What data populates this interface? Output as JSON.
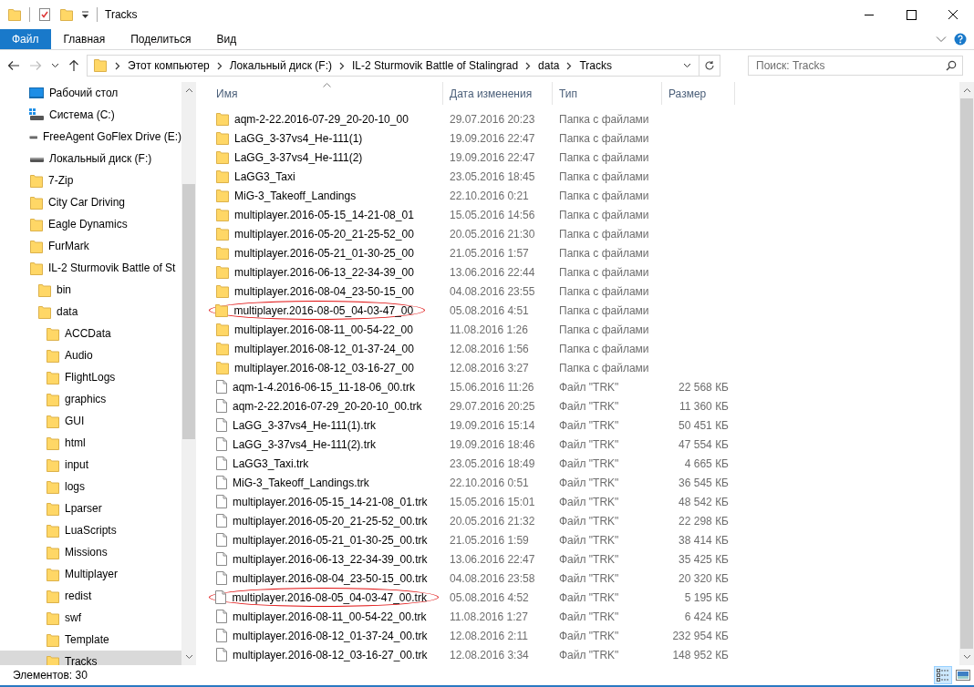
{
  "window": {
    "title": "Tracks"
  },
  "ribbon": {
    "tabs": [
      {
        "label": "Файл",
        "kind": "file-menu"
      },
      {
        "label": "Главная",
        "kind": "tab"
      },
      {
        "label": "Поделиться",
        "kind": "tab"
      },
      {
        "label": "Вид",
        "kind": "tab"
      }
    ]
  },
  "address": {
    "crumbs": [
      "Этот компьютер",
      "Локальный диск (F:)",
      "IL-2 Sturmovik Battle of Stalingrad",
      "data",
      "Tracks"
    ],
    "search_placeholder": "Поиск: Tracks"
  },
  "sidebar": {
    "items": [
      {
        "label": "Рабочий стол",
        "kind": "desktop",
        "selected": false
      },
      {
        "label": "Система (C:)",
        "kind": "system-drive",
        "selected": false
      },
      {
        "label": "FreeAgent GoFlex Drive (E:)",
        "kind": "drive",
        "selected": false
      },
      {
        "label": "Локальный диск (F:)",
        "kind": "drive",
        "selected": false,
        "children": [
          {
            "label": "7-Zip",
            "kind": "folder",
            "selected": false
          },
          {
            "label": "City Car Driving",
            "kind": "folder",
            "selected": false
          },
          {
            "label": "Eagle Dynamics",
            "kind": "folder",
            "selected": false
          },
          {
            "label": "FurMark",
            "kind": "folder",
            "selected": false
          },
          {
            "label": "IL-2 Sturmovik Battle of St",
            "kind": "folder",
            "selected": false,
            "children": [
              {
                "label": "bin",
                "kind": "folder",
                "selected": false
              },
              {
                "label": "data",
                "kind": "folder",
                "selected": false,
                "children": [
                  {
                    "label": "ACCData",
                    "kind": "folder",
                    "selected": false
                  },
                  {
                    "label": "Audio",
                    "kind": "folder",
                    "selected": false
                  },
                  {
                    "label": "FlightLogs",
                    "kind": "folder",
                    "selected": false
                  },
                  {
                    "label": "graphics",
                    "kind": "folder",
                    "selected": false
                  },
                  {
                    "label": "GUI",
                    "kind": "folder",
                    "selected": false
                  },
                  {
                    "label": "html",
                    "kind": "folder",
                    "selected": false
                  },
                  {
                    "label": "input",
                    "kind": "folder",
                    "selected": false
                  },
                  {
                    "label": "logs",
                    "kind": "folder",
                    "selected": false
                  },
                  {
                    "label": "Lparser",
                    "kind": "folder",
                    "selected": false
                  },
                  {
                    "label": "LuaScripts",
                    "kind": "folder",
                    "selected": false
                  },
                  {
                    "label": "Missions",
                    "kind": "folder",
                    "selected": false
                  },
                  {
                    "label": "Multiplayer",
                    "kind": "folder",
                    "selected": false
                  },
                  {
                    "label": "redist",
                    "kind": "folder",
                    "selected": false
                  },
                  {
                    "label": "swf",
                    "kind": "folder",
                    "selected": false
                  },
                  {
                    "label": "Template",
                    "kind": "folder",
                    "selected": false
                  },
                  {
                    "label": "Tracks",
                    "kind": "folder",
                    "selected": true
                  }
                ]
              }
            ]
          }
        ]
      }
    ]
  },
  "table": {
    "columns": [
      {
        "label": "Имя",
        "sorted": true
      },
      {
        "label": "Дата изменения",
        "sorted": false
      },
      {
        "label": "Тип",
        "sorted": false
      },
      {
        "label": "Размер",
        "sorted": false
      }
    ],
    "rows": [
      {
        "kind": "folder",
        "name": "aqm-2-22.2016-07-29_20-20-10_00",
        "date": "29.07.2016 20:23",
        "type": "Папка с файлами",
        "circled": false
      },
      {
        "kind": "folder",
        "name": "LaGG_3-37vs4_He-111(1)",
        "date": "19.09.2016 22:47",
        "type": "Папка с файлами",
        "circled": false
      },
      {
        "kind": "folder",
        "name": "LaGG_3-37vs4_He-111(2)",
        "date": "19.09.2016 22:47",
        "type": "Папка с файлами",
        "circled": false
      },
      {
        "kind": "folder",
        "name": "LaGG3_Taxi",
        "date": "23.05.2016 18:45",
        "type": "Папка с файлами",
        "circled": false
      },
      {
        "kind": "folder",
        "name": "MiG-3_Takeoff_Landings",
        "date": "22.10.2016 0:21",
        "type": "Папка с файлами",
        "circled": false
      },
      {
        "kind": "folder",
        "name": "multiplayer.2016-05-15_14-21-08_01",
        "date": "15.05.2016 14:56",
        "type": "Папка с файлами",
        "circled": false
      },
      {
        "kind": "folder",
        "name": "multiplayer.2016-05-20_21-25-52_00",
        "date": "20.05.2016 21:30",
        "type": "Папка с файлами",
        "circled": false
      },
      {
        "kind": "folder",
        "name": "multiplayer.2016-05-21_01-30-25_00",
        "date": "21.05.2016 1:57",
        "type": "Папка с файлами",
        "circled": false
      },
      {
        "kind": "folder",
        "name": "multiplayer.2016-06-13_22-34-39_00",
        "date": "13.06.2016 22:44",
        "type": "Папка с файлами",
        "circled": false
      },
      {
        "kind": "folder",
        "name": "multiplayer.2016-08-04_23-50-15_00",
        "date": "04.08.2016 23:55",
        "type": "Папка с файлами",
        "circled": false
      },
      {
        "kind": "folder",
        "name": "multiplayer.2016-08-05_04-03-47_00",
        "date": "05.08.2016 4:51",
        "type": "Папка с файлами",
        "circled": true
      },
      {
        "kind": "folder",
        "name": "multiplayer.2016-08-11_00-54-22_00",
        "date": "11.08.2016 1:26",
        "type": "Папка с файлами",
        "circled": false
      },
      {
        "kind": "folder",
        "name": "multiplayer.2016-08-12_01-37-24_00",
        "date": "12.08.2016 1:56",
        "type": "Папка с файлами",
        "circled": false
      },
      {
        "kind": "folder",
        "name": "multiplayer.2016-08-12_03-16-27_00",
        "date": "12.08.2016 3:27",
        "type": "Папка с файлами",
        "circled": false
      },
      {
        "kind": "file",
        "name": "aqm-1-4.2016-06-15_11-18-06_00.trk",
        "date": "15.06.2016 11:26",
        "type": "Файл \"TRK\"",
        "size": "22 568 КБ",
        "circled": false
      },
      {
        "kind": "file",
        "name": "aqm-2-22.2016-07-29_20-20-10_00.trk",
        "date": "29.07.2016 20:25",
        "type": "Файл \"TRK\"",
        "size": "11 360 КБ",
        "circled": false
      },
      {
        "kind": "file",
        "name": "LaGG_3-37vs4_He-111(1).trk",
        "date": "19.09.2016 15:14",
        "type": "Файл \"TRK\"",
        "size": "50 451 КБ",
        "circled": false
      },
      {
        "kind": "file",
        "name": "LaGG_3-37vs4_He-111(2).trk",
        "date": "19.09.2016 18:46",
        "type": "Файл \"TRK\"",
        "size": "47 554 КБ",
        "circled": false
      },
      {
        "kind": "file",
        "name": "LaGG3_Taxi.trk",
        "date": "23.05.2016 18:49",
        "type": "Файл \"TRK\"",
        "size": "4 665 КБ",
        "circled": false
      },
      {
        "kind": "file",
        "name": "MiG-3_Takeoff_Landings.trk",
        "date": "22.10.2016 0:51",
        "type": "Файл \"TRK\"",
        "size": "36 545 КБ",
        "circled": false
      },
      {
        "kind": "file",
        "name": "multiplayer.2016-05-15_14-21-08_01.trk",
        "date": "15.05.2016 15:01",
        "type": "Файл \"TRK\"",
        "size": "48 542 КБ",
        "circled": false
      },
      {
        "kind": "file",
        "name": "multiplayer.2016-05-20_21-25-52_00.trk",
        "date": "20.05.2016 21:32",
        "type": "Файл \"TRK\"",
        "size": "22 298 КБ",
        "circled": false
      },
      {
        "kind": "file",
        "name": "multiplayer.2016-05-21_01-30-25_00.trk",
        "date": "21.05.2016 1:59",
        "type": "Файл \"TRK\"",
        "size": "38 414 КБ",
        "circled": false
      },
      {
        "kind": "file",
        "name": "multiplayer.2016-06-13_22-34-39_00.trk",
        "date": "13.06.2016 22:47",
        "type": "Файл \"TRK\"",
        "size": "35 425 КБ",
        "circled": false
      },
      {
        "kind": "file",
        "name": "multiplayer.2016-08-04_23-50-15_00.trk",
        "date": "04.08.2016 23:58",
        "type": "Файл \"TRK\"",
        "size": "20 320 КБ",
        "circled": false
      },
      {
        "kind": "file",
        "name": "multiplayer.2016-08-05_04-03-47_00.trk",
        "date": "05.08.2016 4:52",
        "type": "Файл \"TRK\"",
        "size": "5 195 КБ",
        "circled": true
      },
      {
        "kind": "file",
        "name": "multiplayer.2016-08-11_00-54-22_00.trk",
        "date": "11.08.2016 1:27",
        "type": "Файл \"TRK\"",
        "size": "6 424 КБ",
        "circled": false
      },
      {
        "kind": "file",
        "name": "multiplayer.2016-08-12_01-37-24_00.trk",
        "date": "12.08.2016 2:11",
        "type": "Файл \"TRK\"",
        "size": "232 954 КБ",
        "circled": false
      },
      {
        "kind": "file",
        "name": "multiplayer.2016-08-12_03-16-27_00.trk",
        "date": "12.08.2016 3:34",
        "type": "Файл \"TRK\"",
        "size": "148 952 КБ",
        "circled": false
      }
    ]
  },
  "status_bar": {
    "count": "Элементов: 30",
    "views": [
      {
        "kind": "details",
        "selected": true
      },
      {
        "kind": "large-icons",
        "selected": false
      }
    ]
  }
}
